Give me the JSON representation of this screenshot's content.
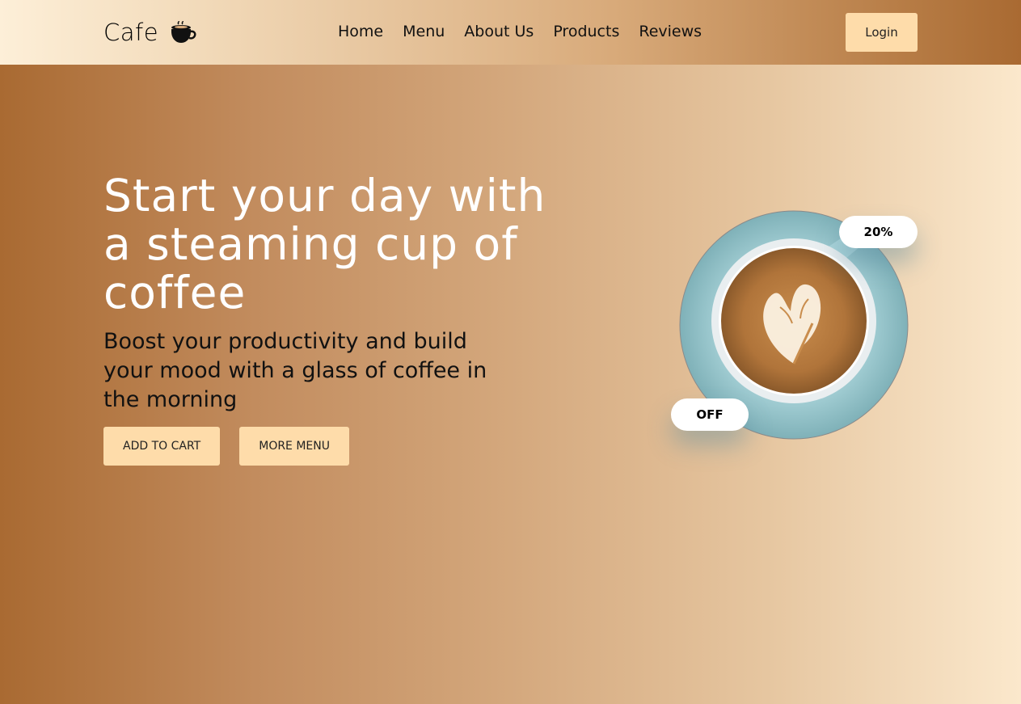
{
  "brand": {
    "name": "Cafe",
    "icon": "coffee-cup-icon"
  },
  "nav": {
    "items": [
      {
        "label": "Home"
      },
      {
        "label": "Menu"
      },
      {
        "label": "About Us"
      },
      {
        "label": "Products"
      },
      {
        "label": "Reviews"
      }
    ],
    "login_label": "Login"
  },
  "hero": {
    "headline": "Start your day with a steaming cup of coffee",
    "subtext": "Boost your productivity and build your mood with a glass of coffee in the morning",
    "buttons": {
      "add_to_cart": "ADD TO CART",
      "more_menu": "MORE MENU"
    },
    "image": {
      "icon": "latte-cup-illustration"
    },
    "badges": {
      "top": "20%",
      "bottom": "OFF"
    }
  },
  "colors": {
    "accent": "#fedcaa",
    "brown_dark": "#a96a32",
    "cream": "#fbe8cc",
    "headline_text": "#ffffff"
  }
}
